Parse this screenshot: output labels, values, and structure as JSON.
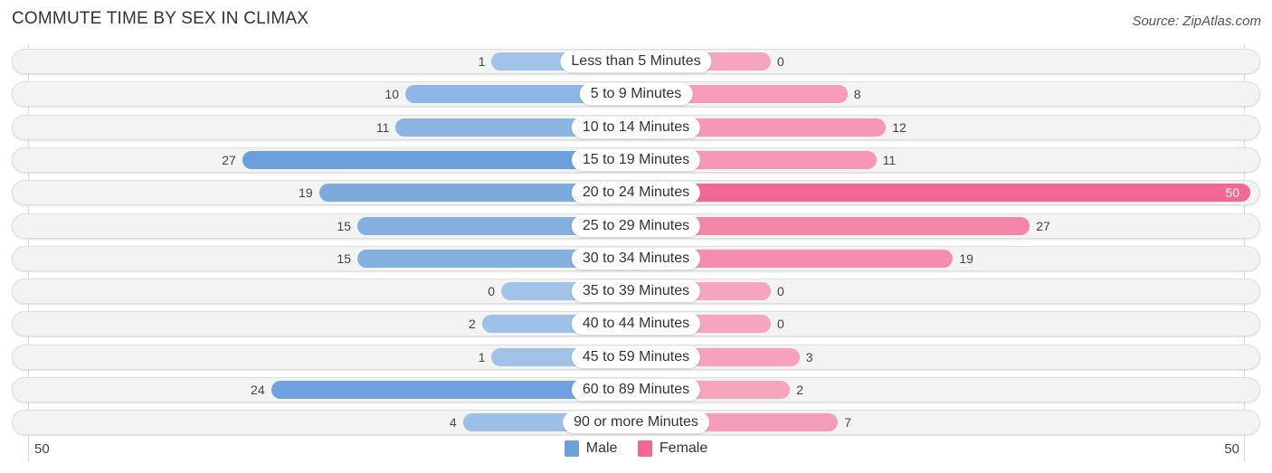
{
  "title": "COMMUTE TIME BY SEX IN CLIMAX",
  "source": "Source: ZipAtlas.com",
  "colors": {
    "male": "#6a9fdb",
    "female": "#f26892",
    "male_light": "#a3c4e9",
    "female_light": "#f7a6bf"
  },
  "chart_data": {
    "type": "bar",
    "orientation": "horizontal-diverging",
    "title": "COMMUTE TIME BY SEX IN CLIMAX",
    "categories": [
      "Less than 5 Minutes",
      "5 to 9 Minutes",
      "10 to 14 Minutes",
      "15 to 19 Minutes",
      "20 to 24 Minutes",
      "25 to 29 Minutes",
      "30 to 34 Minutes",
      "35 to 39 Minutes",
      "40 to 44 Minutes",
      "45 to 59 Minutes",
      "60 to 89 Minutes",
      "90 or more Minutes"
    ],
    "series": [
      {
        "name": "Male",
        "values": [
          1,
          10,
          11,
          27,
          19,
          15,
          15,
          0,
          2,
          1,
          24,
          4
        ]
      },
      {
        "name": "Female",
        "values": [
          0,
          8,
          12,
          11,
          50,
          27,
          19,
          0,
          0,
          3,
          2,
          7
        ]
      }
    ],
    "axis_max": 50,
    "tick_labels": {
      "left": "50",
      "right": "50"
    },
    "legend": {
      "items": [
        "Male",
        "Female"
      ],
      "position": "bottom-center"
    }
  }
}
